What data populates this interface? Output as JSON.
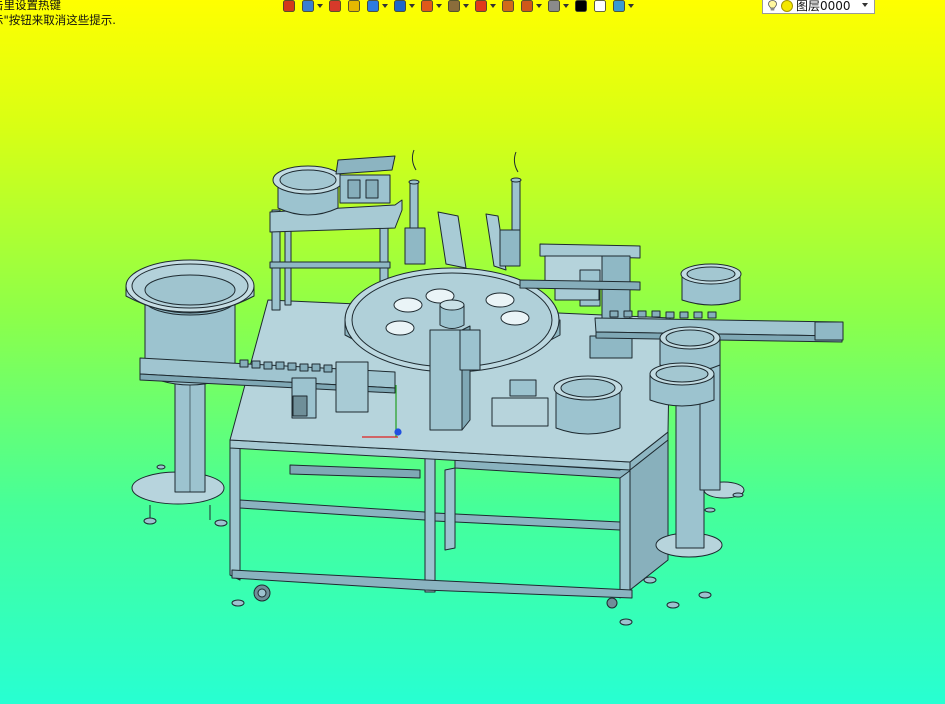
{
  "hints": {
    "line1": "击里设置热键",
    "line2": "示\"按钮来取消这些提示."
  },
  "toolbar": {
    "tools": [
      {
        "icon": "return-arrow-icon",
        "color": "#d23b1a",
        "has_dropdown": false
      },
      {
        "icon": "layers-stack-icon",
        "color": "#3a7fd0",
        "has_dropdown": true
      },
      {
        "icon": "pencil-icon",
        "color": "#d63a2a",
        "has_dropdown": false
      },
      {
        "icon": "cube-yellow-icon",
        "color": "#e6b800",
        "has_dropdown": false
      },
      {
        "icon": "cube-blue-icon",
        "color": "#2c7be0",
        "has_dropdown": true
      },
      {
        "icon": "cube-shaded-icon",
        "color": "#1f66c8",
        "has_dropdown": true
      },
      {
        "icon": "wheel-section-icon",
        "color": "#e05a1a",
        "has_dropdown": true
      },
      {
        "icon": "render-image-icon",
        "color": "#8a6d3b",
        "has_dropdown": true
      },
      {
        "icon": "crosshair-icon",
        "color": "#e03a1a",
        "has_dropdown": true
      },
      {
        "icon": "page-view-icon",
        "color": "#d06a1a",
        "has_dropdown": false
      },
      {
        "icon": "frame-view-icon",
        "color": "#d0581a",
        "has_dropdown": true
      },
      {
        "icon": "cylinder-icon",
        "color": "#8a8a8a",
        "has_dropdown": true
      },
      {
        "icon": "line-color-icon",
        "color": "#000000",
        "has_dropdown": false
      },
      {
        "icon": "blank-page-icon",
        "color": "#ffffff",
        "has_dropdown": false
      },
      {
        "icon": "layer-manager-icon",
        "color": "#3a9ad0",
        "has_dropdown": true
      }
    ]
  },
  "layer": {
    "current": "图层0000"
  },
  "model": {
    "body_color": "#9cc3cf",
    "edge_color": "#1e2a30"
  }
}
